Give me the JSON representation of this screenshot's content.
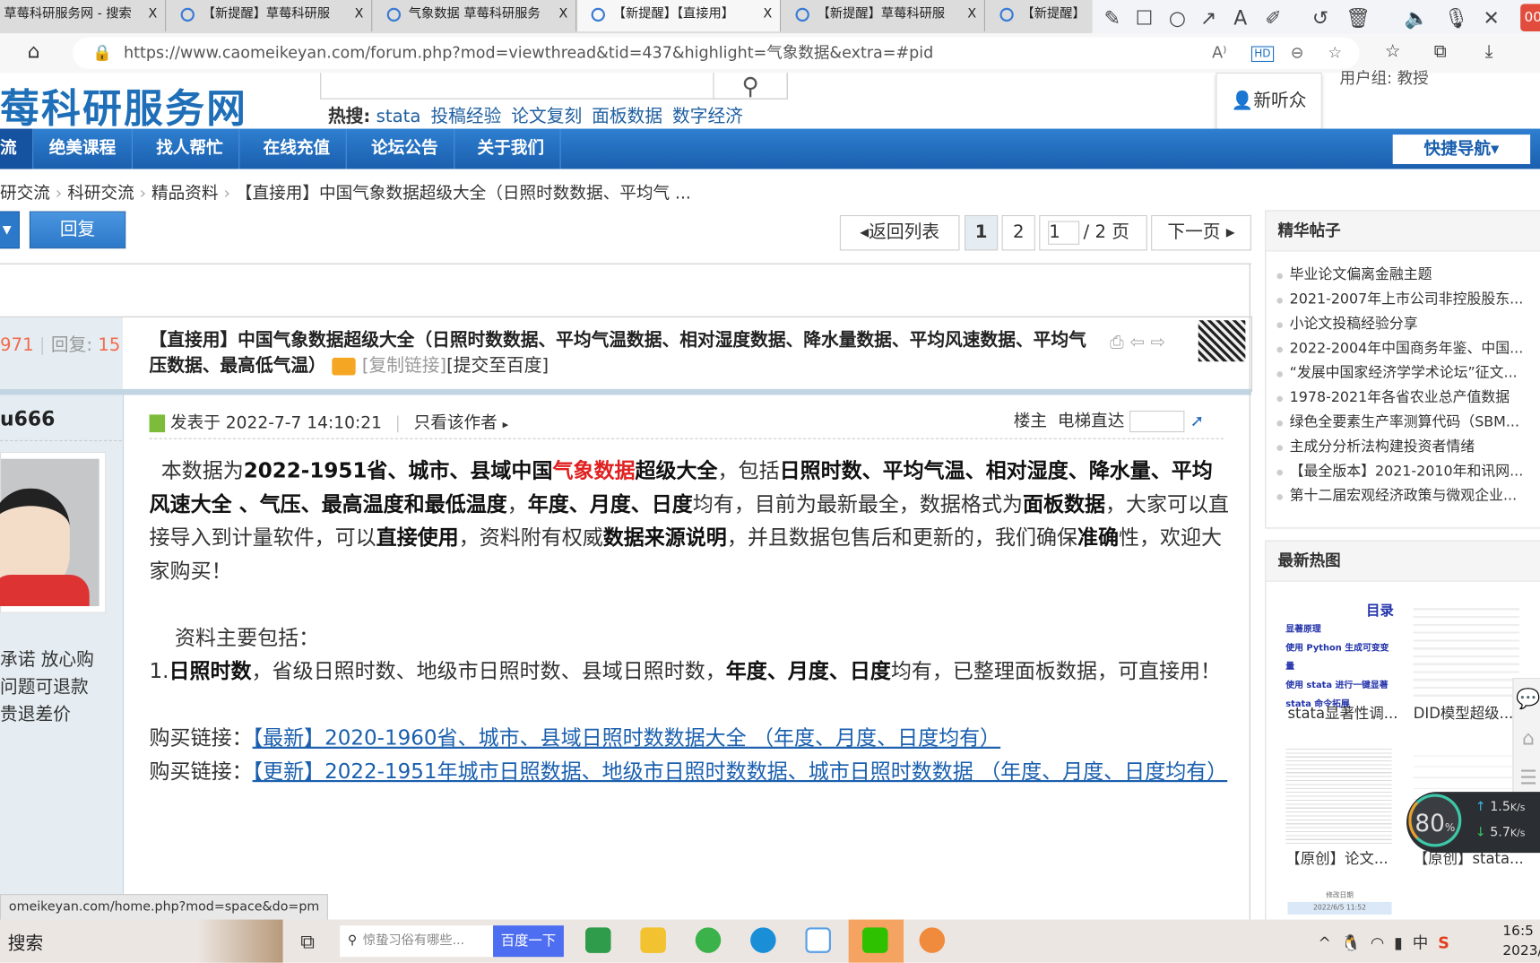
{
  "browser": {
    "tabs": [
      {
        "title": "草莓科研服务网 - 搜索",
        "active": false
      },
      {
        "title": "【新提醒】草莓科研服",
        "active": false
      },
      {
        "title": "气象数据 草莓科研服务",
        "active": false
      },
      {
        "title": "【新提醒】【直接用】",
        "active": true
      },
      {
        "title": "【新提醒】草莓科研服",
        "active": false
      },
      {
        "title": "【新提醒】",
        "active": false
      }
    ],
    "close_glyph": "X",
    "url": "https://www.caomeikeyan.com/forum.php?mod=viewthread&tid=437&highlight=气象数据&extra=#pid",
    "status_url": "omeikeyan.com/home.php?mod=space&do=pm"
  },
  "annotation_toolbar": {
    "icons": [
      "pencil-icon",
      "rectangle-icon",
      "circle-icon",
      "arrow-icon",
      "text-icon",
      "highlighter-icon",
      "undo-icon",
      "delete-icon",
      "speaker-icon",
      "microphone-icon",
      "close-icon"
    ],
    "badge": "00"
  },
  "header": {
    "logo": "莓科研服务网",
    "hot_label": "热搜:",
    "hot": [
      "stata",
      "投稿经验",
      "论文复刻",
      "面板数据",
      "数字经济"
    ],
    "user_dropdown": "新听众",
    "user_group_partial": "用户组: 教授"
  },
  "nav": {
    "items": [
      "流",
      "绝美课程",
      "找人帮忙",
      "在线充值",
      "论坛公告",
      "关于我们"
    ],
    "quick": "快捷导航"
  },
  "breadcrumb": [
    "研交流",
    "科研交流",
    "精品资料",
    "【直接用】中国气象数据超级大全（日照时数数据、平均气 ..."
  ],
  "toolbar": {
    "reply": "回复",
    "back": "返回列表",
    "pages": [
      "1",
      "2"
    ],
    "page_input": "1",
    "page_total": "/ 2 页",
    "next": "下一页"
  },
  "thread": {
    "views_partial": "971",
    "replies_label": "回复:",
    "replies": "15",
    "title": "【直接用】中国气象数据超级大全（日照时数数据、平均气温数据、相对湿度数据、降水量数据、平均风速数据、平均气压数据、最高低气温）",
    "copy_link": "[复制链接]",
    "submit_baidu": "[提交至百度]",
    "author_partial": "u666",
    "posted": "发表于 2022-7-7 14:10:21",
    "only_author": "只看该作者",
    "floor": "楼主",
    "elevator": "电梯直达",
    "promises": [
      "承诺 放心购",
      "问题可退款",
      "贵退差价"
    ]
  },
  "post": {
    "p1": [
      "本数据为",
      "2022-1951省、城市、县域中国",
      "气象数据",
      "超级大全",
      "，包括",
      "日照时数、平均气温、相对湿度、降水量、平均风速大全 、气压、最高温度和最低温度",
      "，",
      "年度、月度、日度",
      "均有，目前为最新最全，数据格式为",
      "面板数据",
      "，大家可以直接导入到计量软件，可以",
      "直接使用",
      "，资料附有权威",
      "数据来源说明",
      "，并且数据包售后和更新的，我们确保",
      "准确",
      "性，欢迎大家购买！"
    ],
    "intro": "资料主要包括：",
    "item1": [
      "1.",
      "日照时数",
      "，省级日照时数、地级市日照时数、县域日照时数，",
      "年度、月度、日度",
      "均有，已整理面板数据，可直接用！"
    ],
    "buy_label": "购买链接：",
    "links": [
      "【最新】2020-1960省、城市、县域日照时数数据大全 （年度、月度、日度均有）",
      "【更新】2022-1951年城市日照数据、地级市日照时数数据、城市日照时数数据 （年度、月度、日度均有）"
    ]
  },
  "sidebar": {
    "featured_title": "精华帖子",
    "featured": [
      "毕业论文偏离金融主题",
      "2021-2007年上市公司非控股股东...",
      "小论文投稿经验分享",
      "2022-2004年中国商务年鉴、中国...",
      "“发展中国家经济学学术论坛”征文...",
      "1978-2021年各省农业总产值数据",
      "绿色全要素生产率测算代码（SBM...",
      "主成分分析法构建投资者情绪",
      "【最全版本】2021-2010年和讯网...",
      "第十二届宏观经济政策与微观企业..."
    ],
    "hot_title": "最新热图",
    "hot_images": [
      "stata显著性调...",
      "DID模型超级...",
      "【原创】论文...",
      "【原创】stata..."
    ],
    "thumb1_lines": [
      "目录",
      "显著原理",
      "使用 Python 生成可变变量",
      "使用 stata 进行一键显著",
      "stata 命令拓展"
    ],
    "thumb5_lines": [
      "修改日期",
      "2022/6/5 11:52"
    ]
  },
  "net_widget": {
    "percent": "80",
    "unit": "%",
    "up": "1.5",
    "down": "5.7",
    "rate_unit": "K/s"
  },
  "taskbar": {
    "search": "搜索",
    "search_box_placeholder": "惊蛰习俗有哪些...",
    "baidu_button": "百度一下",
    "time": "16:5",
    "date": "2023/"
  }
}
